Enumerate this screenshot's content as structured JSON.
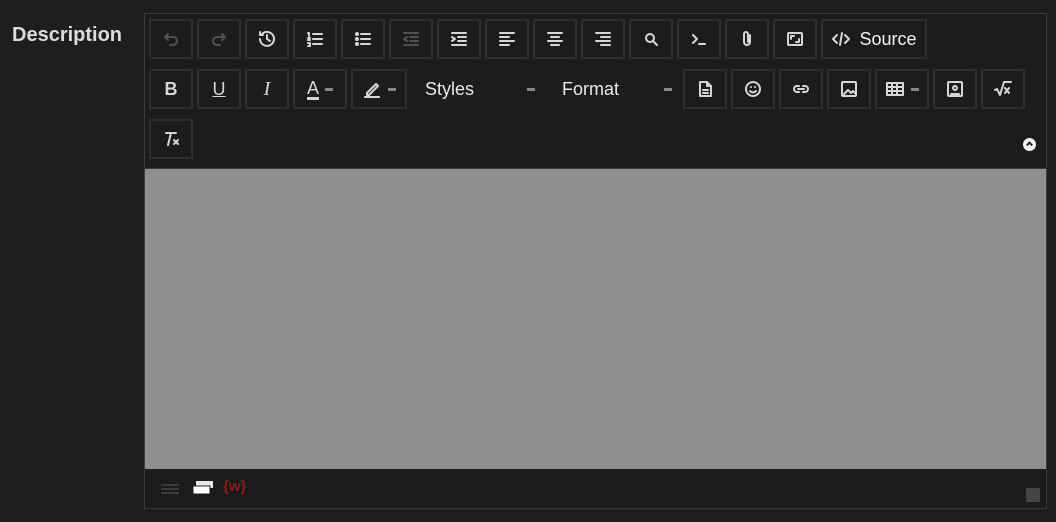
{
  "field": {
    "label": "Description"
  },
  "toolbar": {
    "row1": [
      {
        "name": "undo-button",
        "icon": "undo-icon",
        "disabled": true
      },
      {
        "name": "redo-button",
        "icon": "redo-icon",
        "disabled": true
      },
      {
        "name": "history-button",
        "icon": "history-icon"
      },
      {
        "name": "numbered-list-button",
        "icon": "numbered-list-icon"
      },
      {
        "name": "bulleted-list-button",
        "icon": "bulleted-list-icon"
      },
      {
        "name": "outdent-button",
        "icon": "outdent-icon",
        "disabled": true
      },
      {
        "name": "indent-button",
        "icon": "indent-icon"
      },
      {
        "name": "align-left-button",
        "icon": "align-left-icon"
      },
      {
        "name": "align-center-button",
        "icon": "align-center-icon"
      },
      {
        "name": "align-right-button",
        "icon": "align-right-icon"
      },
      {
        "name": "find-replace-button",
        "icon": "find-replace-icon"
      },
      {
        "name": "code-snippet-button",
        "icon": "terminal-icon"
      },
      {
        "name": "attachment-button",
        "icon": "paperclip-icon"
      },
      {
        "name": "maximize-button",
        "icon": "maximize-icon"
      }
    ],
    "source_label": "Source",
    "styles_label": "Styles",
    "format_label": "Format"
  },
  "statusbar": {
    "badge": "{w}"
  },
  "colors": {
    "background": "#1e1e1e",
    "editor_area": "#8f8f8f",
    "badge": "#8c1c1c"
  }
}
